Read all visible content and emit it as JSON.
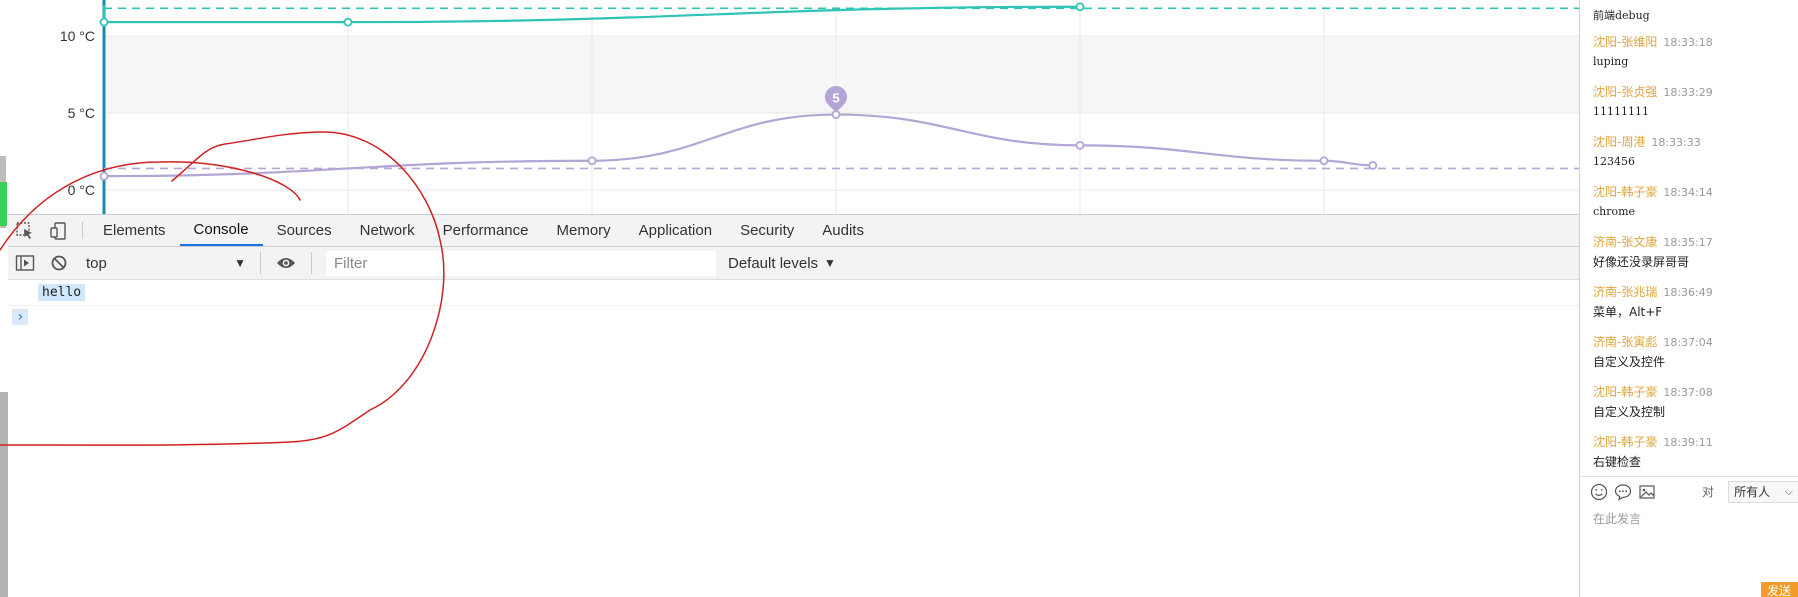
{
  "colors": {
    "series_teal": "#2ec4b6",
    "series_purple": "#b3a5d6",
    "axis_blue": "#1e88b5",
    "annotation_red": "#d02020",
    "chat_name": "#e0a53a",
    "send_button": "#f39b2b",
    "tab_active": "#1a73e8"
  },
  "chart_data": {
    "type": "line",
    "yunit": "°C",
    "yticks": [
      {
        "value": 10,
        "label": "10 °C"
      },
      {
        "value": 5,
        "label": "5 °C"
      },
      {
        "value": 0,
        "label": "0 °C"
      }
    ],
    "ylim": [
      -1.3,
      12.0
    ],
    "grid": true,
    "series": [
      {
        "color": "#2ec4b6",
        "points": [
          [
            0,
            12.0
          ],
          [
            0,
            10.9
          ],
          [
            1,
            10.9
          ],
          [
            4,
            11.9
          ]
        ],
        "mark_line": 11.8
      },
      {
        "color": "#b3a5d6",
        "points": [
          [
            0,
            0.9
          ],
          [
            2,
            1.9
          ],
          [
            3,
            4.9
          ],
          [
            4,
            2.9
          ],
          [
            5,
            1.9
          ],
          [
            5.2,
            1.6
          ]
        ],
        "mark_line": 1.4,
        "max_pin": {
          "x": 3,
          "value": 4.9,
          "label": "5"
        }
      }
    ]
  },
  "devtools": {
    "tabs": [
      "Elements",
      "Console",
      "Sources",
      "Network",
      "Performance",
      "Memory",
      "Application",
      "Security",
      "Audits"
    ],
    "active_tab": "Console",
    "context": "top",
    "filter_placeholder": "Filter",
    "levels": "Default levels",
    "log": "hello",
    "prompt": "›"
  },
  "chat": {
    "messages": [
      {
        "name": "",
        "time": "",
        "text": "前端debug"
      },
      {
        "name": "沈阳-张维阳",
        "time": "18:33:18",
        "text": "luping"
      },
      {
        "name": "沈阳-张贞强",
        "time": "18:33:29",
        "text": "11111111"
      },
      {
        "name": "沈阳-周港",
        "time": "18:33:33",
        "text": "123456"
      },
      {
        "name": "沈阳-韩子豪",
        "time": "18:34:14",
        "text": "chrome"
      },
      {
        "name": "济南-张文康",
        "time": "18:35:17",
        "text": "好像还没录屏哥哥"
      },
      {
        "name": "济南-张兆瑞",
        "time": "18:36:49",
        "text": "菜单，Alt+F"
      },
      {
        "name": "济南-张寅彪",
        "time": "18:37:04",
        "text": "自定义及控件"
      },
      {
        "name": "沈阳-韩子豪",
        "time": "18:37:08",
        "text": "自定义及控制"
      },
      {
        "name": "沈阳-韩子豪",
        "time": "18:39:11",
        "text": "右键检查"
      }
    ],
    "to_label": "对",
    "recipient": "所有人",
    "input_placeholder": "在此发言",
    "send_label": "发送"
  }
}
